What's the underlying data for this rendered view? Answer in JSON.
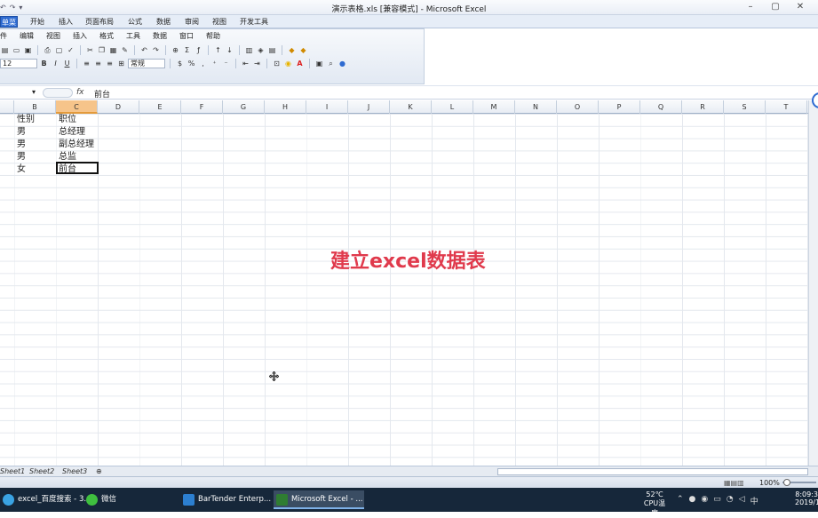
{
  "window": {
    "title": "演示表格.xls  [兼容模式] - Microsoft Excel",
    "controls": [
      "–",
      "▢",
      "✕"
    ]
  },
  "quick_access": [
    "↶",
    "↷",
    "▾"
  ],
  "tabs": [
    "单菜单",
    "开始",
    "插入",
    "页面布局",
    "公式",
    "数据",
    "审阅",
    "视图",
    "开发工具"
  ],
  "menus": [
    "件",
    "编辑",
    "视图",
    "插入",
    "格式",
    "工具",
    "数据",
    "窗口",
    "帮助"
  ],
  "font_size": "12",
  "number_format": "常规",
  "name_box": "",
  "formula_fx": "fx",
  "formula": "前台",
  "columns": [
    "B",
    "C",
    "D",
    "E",
    "F",
    "G",
    "H",
    "I",
    "J",
    "K",
    "L",
    "M",
    "N",
    "O",
    "P",
    "Q",
    "R",
    "S",
    "T"
  ],
  "cells": {
    "b1": "性别",
    "c1": "职位",
    "b2": "男",
    "c2": "总经理",
    "b3": "男",
    "c3": "副总经理",
    "b4": "男",
    "c4": "总监",
    "b5": "女",
    "c5": "前台"
  },
  "overlay_text": "建立excel数据表",
  "sheets": [
    "Sheet1",
    "Sheet2",
    "Sheet3"
  ],
  "zoom": "100%",
  "taskbar": {
    "buttons": [
      "excel_百度搜索 - 3...",
      "微信",
      "BarTender Enterp...",
      "Microsoft Excel - ..."
    ],
    "temp": "52℃",
    "temp_label": "CPU温度",
    "time": "8:09:3",
    "date": "2019/1",
    "ime": "中"
  },
  "colors": {
    "accent": "#2e6bd1",
    "overlay": "#e03a4c",
    "taskbar": "#16273a",
    "selected_col": "#f6c48a"
  }
}
